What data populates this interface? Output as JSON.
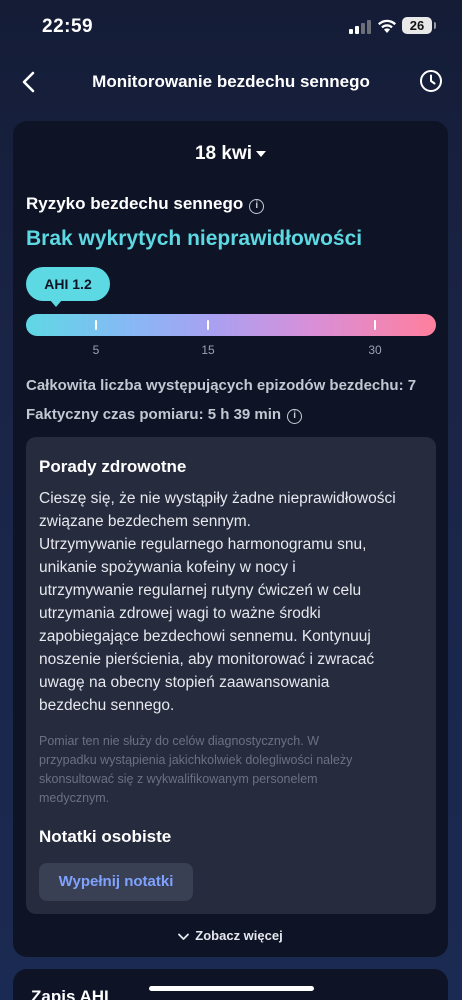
{
  "status_bar": {
    "time": "22:59",
    "battery": "26"
  },
  "header": {
    "title": "Monitorowanie bezdechu sennego",
    "back_icon": "chevron-left-icon",
    "history_icon": "clock-icon"
  },
  "card": {
    "date": "18 kwi",
    "risk_title": "Ryzyko bezdechu sennego",
    "risk_result": "Brak wykrytych nieprawidłowości",
    "ahi_label": "AHI 1.2",
    "ahi_value": 1.2,
    "scale_ticks": [
      "5",
      "15",
      "30"
    ],
    "episodes": "Całkowita liczba występujących epizodów bezdechu: 7",
    "duration": "Faktyczny czas pomiaru: 5 h 39 min",
    "colors": {
      "accent": "#5cd9e2",
      "link": "#7fa2ff"
    }
  },
  "tips": {
    "title": "Porady zdrowotne",
    "body_lines": [
      "Cieszę się, że nie wystąpiły żadne nieprawidłowości",
      "związane bezdechem sennym.",
      "Utrzymywanie regularnego harmonogramu snu,",
      "unikanie spożywania kofeiny w nocy i",
      "utrzymywanie regularnej rutyny ćwiczeń w celu",
      "utrzymania zdrowej wagi to ważne środki",
      "zapobiegające bezdechowi sennemu. Kontynuuj",
      "noszenie pierścienia, aby monitorować i zwracać",
      "uwagę na obecny stopień zaawansowania",
      "bezdechu sennego."
    ],
    "disclaimer_lines": [
      "Pomiar ten nie służy do celów diagnostycznych. W",
      "przypadku wystąpienia jakichkolwiek dolegliwości należy",
      "skonsultować się z wykwalifikowanym personelem",
      "medycznym."
    ],
    "notes_title": "Notatki osobiste",
    "notes_button": "Wypełnij notatki"
  },
  "see_more": "Zobacz więcej",
  "next_card_title": "Zapis AHI"
}
